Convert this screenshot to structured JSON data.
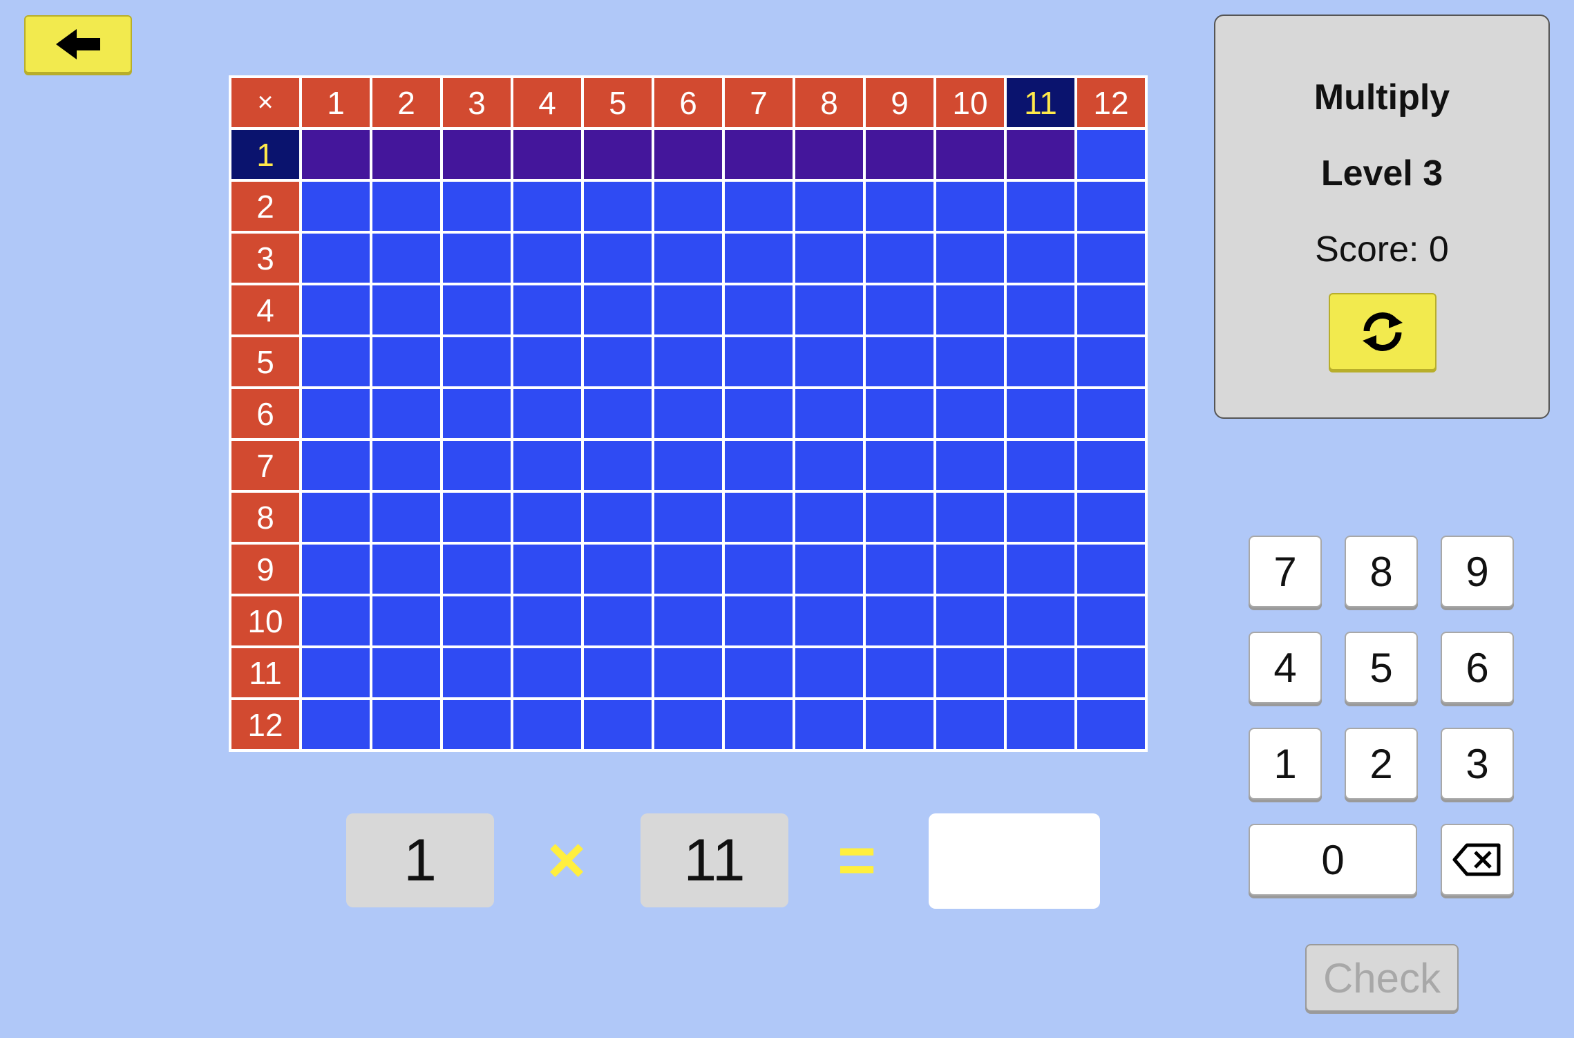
{
  "game": {
    "title": "Multiply",
    "level": "Level 3",
    "score": "Score: 0"
  },
  "grid": {
    "corner_symbol": "×",
    "column_headers": [
      "1",
      "2",
      "3",
      "4",
      "5",
      "6",
      "7",
      "8",
      "9",
      "10",
      "11",
      "12"
    ],
    "row_headers": [
      "1",
      "2",
      "3",
      "4",
      "5",
      "6",
      "7",
      "8",
      "9",
      "10",
      "11",
      "12"
    ],
    "selected_row": "1",
    "selected_column": "11"
  },
  "equation": {
    "left": "1",
    "operator": "×",
    "right": "11",
    "equals": "=",
    "answer": ""
  },
  "keypad": {
    "keys": [
      "7",
      "8",
      "9",
      "4",
      "5",
      "6",
      "1",
      "2",
      "3",
      "0"
    ],
    "backspace_icon": "backspace-icon"
  },
  "buttons": {
    "check_label": "Check",
    "back_icon": "arrow-left-icon",
    "refresh_icon": "refresh-icon"
  },
  "colors": {
    "background": "#b0c8f8",
    "header": "#d24a30",
    "cell": "#2f4bf3",
    "highlight_row": "#44169b",
    "selected_header": "#0a136e",
    "selected_text": "#ffe94a",
    "button_yellow": "#f2ea4e"
  }
}
